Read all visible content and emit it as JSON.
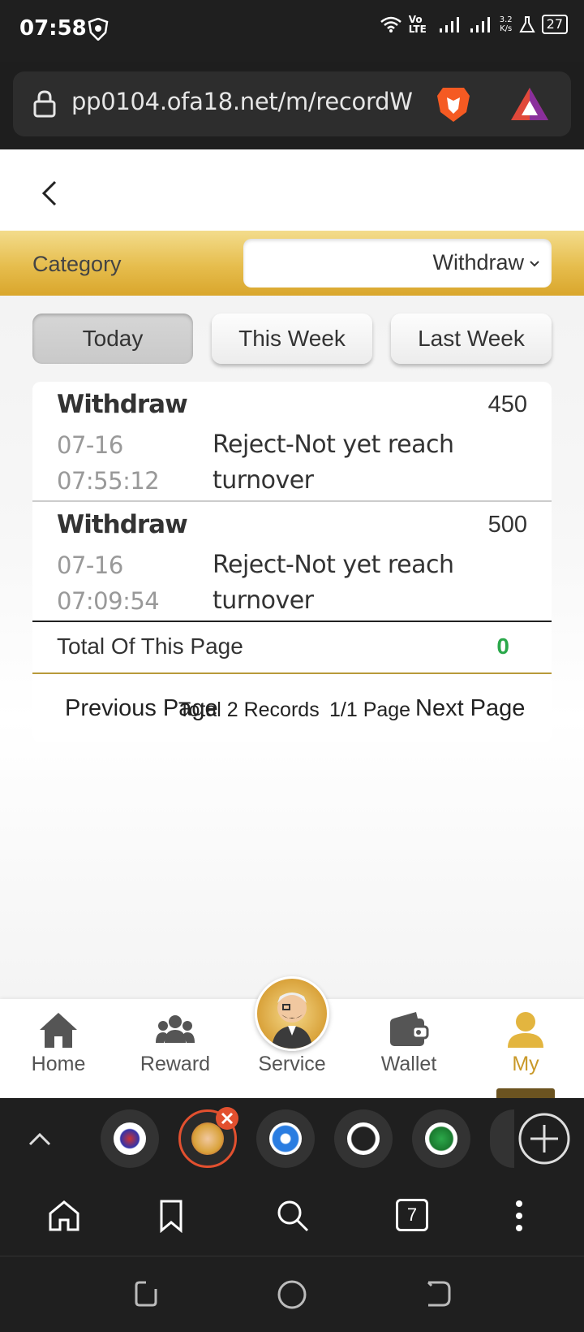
{
  "status_bar": {
    "time": "07:58",
    "network": "Vo LTE",
    "speed_value": "3.2",
    "speed_unit": "K/s",
    "battery": "27"
  },
  "browser": {
    "url": "pp0104.ofa18.net/m/recordW",
    "tab_count": "7"
  },
  "filter": {
    "category_label": "Category",
    "category_value": "Withdraw"
  },
  "tabs": [
    {
      "label": "Today",
      "active": true
    },
    {
      "label": "This Week",
      "active": false
    },
    {
      "label": "Last Week",
      "active": false
    }
  ],
  "records": [
    {
      "type": "Withdraw",
      "amount": "450",
      "date": "07-16",
      "time": "07:55:12",
      "status_line1": "Reject-Not yet reach",
      "status_line2": "turnover"
    },
    {
      "type": "Withdraw",
      "amount": "500",
      "date": "07-16",
      "time": "07:09:54",
      "status_line1": "Reject-Not yet reach",
      "status_line2": "turnover"
    }
  ],
  "summary": {
    "total_label": "Total Of This Page",
    "total_value": "0"
  },
  "pager": {
    "previous": "Previous Page",
    "total_records": "Total 2 Records",
    "page_info": "1/1 Page",
    "next": "Next Page"
  },
  "bottom_nav": [
    {
      "label": "Home",
      "icon": "home-icon"
    },
    {
      "label": "Reward",
      "icon": "group-icon"
    },
    {
      "label": "Service",
      "icon": "service-avatar"
    },
    {
      "label": "Wallet",
      "icon": "wallet-icon"
    },
    {
      "label": "My",
      "icon": "user-icon",
      "active": true
    }
  ],
  "colors": {
    "gold": "#e6bd4d",
    "active_nav": "#c9992a",
    "total_green": "#2aa84a"
  }
}
